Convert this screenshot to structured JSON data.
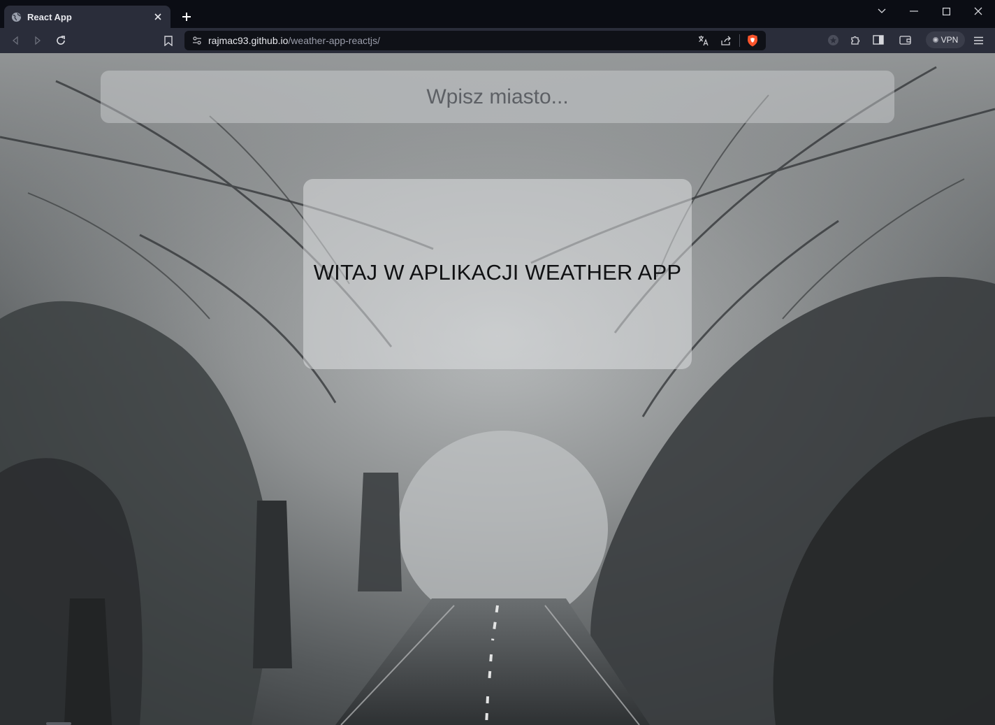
{
  "browser": {
    "tab_title": "React App",
    "url_domain": "rajmac93.github.io",
    "url_path": "/weather-app-reactjs/",
    "vpn_label": "VPN",
    "icons": [
      "globe-icon",
      "close-icon",
      "plus-icon",
      "back-icon",
      "forward-icon",
      "reload-icon",
      "bookmark-icon",
      "site-info-icon",
      "translate-icon",
      "share-icon",
      "brave-shield-icon",
      "rewards-icon",
      "extensions-icon",
      "sidebar-icon",
      "wallet-icon",
      "menu-icon",
      "minimize-icon",
      "maximize-icon",
      "chevron-down-icon"
    ]
  },
  "app": {
    "search_placeholder": "Wpisz miasto...",
    "welcome_title": "WITAJ W APLIKACJI WEATHER APP"
  },
  "colors": {
    "chrome_dark": "#0b0d14",
    "chrome_toolbar": "#2a2d3a",
    "brave_orange": "#fb542b",
    "fog_light": "#c9cccd",
    "fog_dark": "#2d3032"
  }
}
